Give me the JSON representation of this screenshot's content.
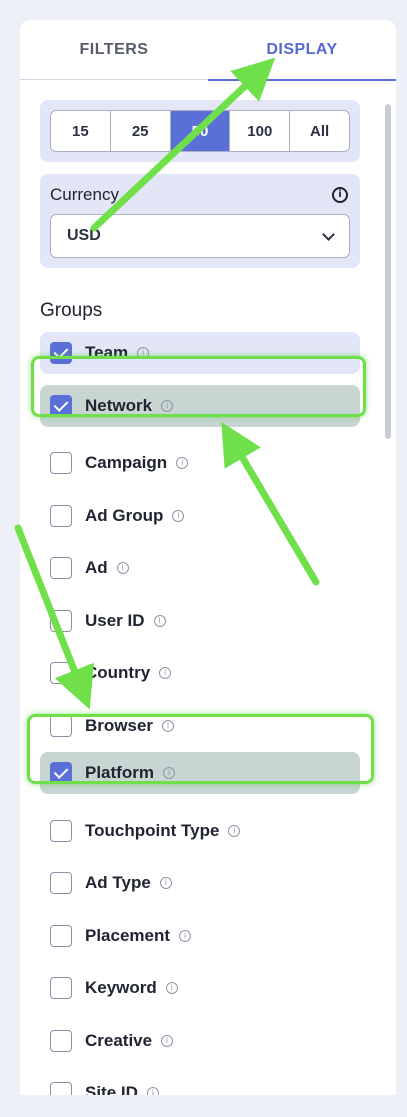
{
  "tabs": [
    {
      "label": "FILTERS",
      "active": false
    },
    {
      "label": "DISPLAY",
      "active": true
    }
  ],
  "page_size": {
    "options": [
      "15",
      "25",
      "50",
      "100",
      "All"
    ],
    "selected": "50"
  },
  "currency": {
    "label": "Currency",
    "info_icon": "info-icon",
    "value": "USD"
  },
  "groups": {
    "title": "Groups",
    "items": [
      {
        "label": "Team",
        "checked": true
      },
      {
        "label": "Network",
        "checked": true
      },
      {
        "label": "Campaign",
        "checked": false
      },
      {
        "label": "Ad Group",
        "checked": false
      },
      {
        "label": "Ad",
        "checked": false
      },
      {
        "label": "User ID",
        "checked": false
      },
      {
        "label": "Country",
        "checked": false
      },
      {
        "label": "Browser",
        "checked": false
      },
      {
        "label": "Platform",
        "checked": true
      },
      {
        "label": "Touchpoint Type",
        "checked": false
      },
      {
        "label": "Ad Type",
        "checked": false
      },
      {
        "label": "Placement",
        "checked": false
      },
      {
        "label": "Keyword",
        "checked": false
      },
      {
        "label": "Creative",
        "checked": false
      },
      {
        "label": "Site ID",
        "checked": false
      }
    ]
  },
  "colors": {
    "accent": "#5a6fd8",
    "highlight_frame": "#6fe04a",
    "arrow": "#6fe04a"
  }
}
